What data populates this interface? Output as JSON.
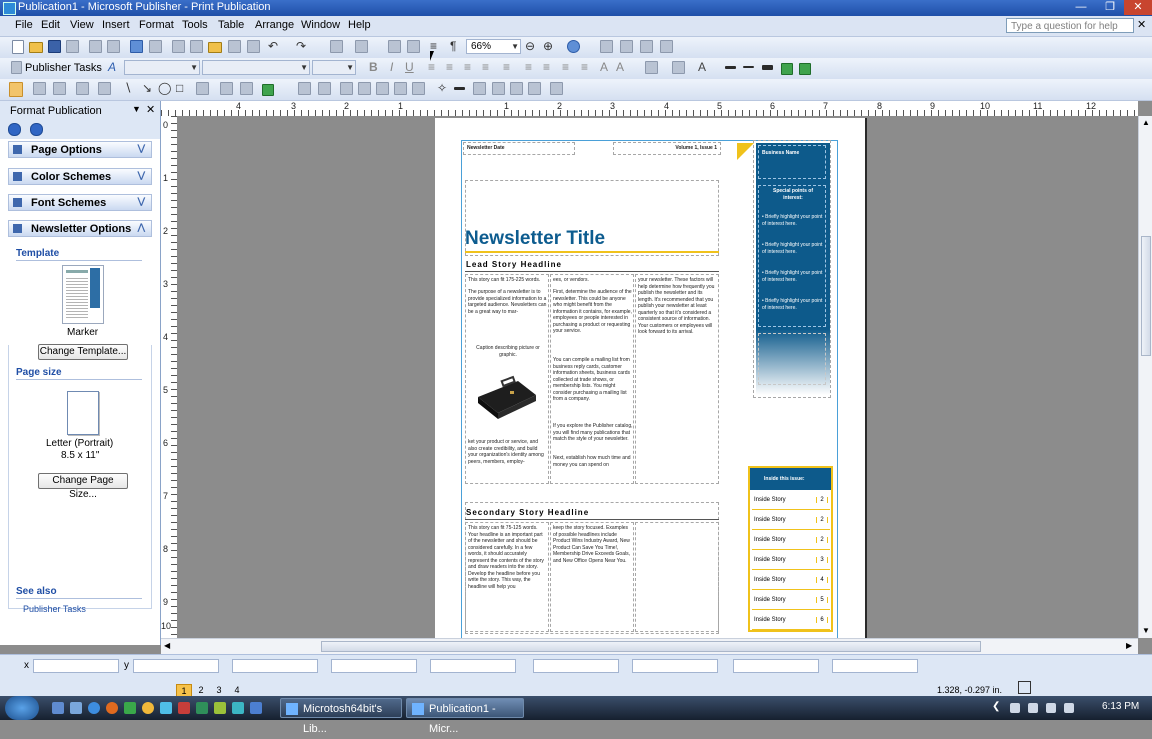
{
  "window": {
    "title": "Publication1 - Microsoft Publisher - Print Publication"
  },
  "menu": [
    "File",
    "Edit",
    "View",
    "Insert",
    "Format",
    "Tools",
    "Table",
    "Arrange",
    "Window",
    "Help"
  ],
  "help_placeholder": "Type a question for help",
  "toolbar": {
    "zoom": "66%",
    "publisher_tasks": "Publisher Tasks"
  },
  "taskpane": {
    "title": "Format Publication",
    "sections": [
      "Page Options",
      "Color Schemes",
      "Font Schemes",
      "Newsletter Options"
    ],
    "template_heading": "Template",
    "template_name": "Marker",
    "change_template": "Change Template...",
    "page_size_heading": "Page size",
    "page_size_name": "Letter (Portrait)",
    "page_size_dims": "8.5 x 11\"",
    "change_page_size": "Change Page Size...",
    "see_also": "See also",
    "see_also_link": "Publisher Tasks"
  },
  "rulers": {
    "h": [
      "4",
      "3",
      "2",
      "1",
      "1",
      "2",
      "3",
      "4",
      "5",
      "6",
      "7",
      "8",
      "9",
      "10",
      "11",
      "12"
    ],
    "v": [
      "0",
      "1",
      "2",
      "3",
      "4",
      "5",
      "6",
      "7",
      "8",
      "9",
      "10"
    ]
  },
  "newsletter": {
    "date": "Newsletter Date",
    "volume": "Volume 1, Issue 1",
    "title": "Newsletter Title",
    "lead_headline": "Lead Story Headline",
    "col1_a": "This story can fit 175-225 words.",
    "col1_b": "The purpose of a newsletter is to provide specialized information to a targeted audience. Newsletters can be a great way to mar-",
    "caption": "Caption describing picture or graphic.",
    "col1_c": "ket your product or service, and also create credibility, and build your organization's identity among peers, members, employ-",
    "col2_a": "ees, or vendors.",
    "col2_b": "First, determine the audience of the newsletter. This could be anyone who might benefit from the information it contains, for example, employees or people interested in purchasing a product or requesting your service.",
    "col2_c": "You can compile a mailing list from business reply cards, customer information sheets, business cards collected at trade shows, or membership lists. You might consider purchasing a mailing list from a company.",
    "col2_d": "If you explore the Publisher catalog, you will find many publications that match the style of your newsletter.",
    "col2_e": "Next, establish how much time and money you can spend on",
    "col3_a": "your newsletter. These factors will help determine how frequently you publish the newsletter and its length. It's recommended that you publish your newsletter at least quarterly so that it's considered a consistent source of information. Your customers or employees will look forward to its arrival.",
    "business_name": "Business Name",
    "special_points": "Special points of interest:",
    "bullets": [
      "Briefly highlight your point of interest here.",
      "Briefly highlight your point of interest here.",
      "Briefly highlight your point of interest here.",
      "Briefly highlight your point of interest here."
    ],
    "secondary_headline": "Secondary Story Headline",
    "sec_col1": "This story can fit 75-125 words. Your headline is an important part of the newsletter and should be considered carefully. In a few words, it should accurately represent the contents of the story and draw readers into the story. Develop the headline before you write the story. This way, the headline will help you",
    "sec_col2": "keep the story focused. Examples of possible headlines include Product Wins Industry Award, New Product Can Save You Time!, Membership Drive Exceeds Goals, and New Office Opens Near You.",
    "inside_title": "Inside this issue:",
    "inside_rows": [
      {
        "label": "Inside Story",
        "page": "2"
      },
      {
        "label": "Inside Story",
        "page": "2"
      },
      {
        "label": "Inside Story",
        "page": "2"
      },
      {
        "label": "Inside Story",
        "page": "3"
      },
      {
        "label": "Inside Story",
        "page": "4"
      },
      {
        "label": "Inside Story",
        "page": "5"
      },
      {
        "label": "Inside Story",
        "page": "6"
      }
    ]
  },
  "status": {
    "x_label": "x",
    "y_label": "y",
    "pages": [
      "1",
      "2",
      "3",
      "4"
    ],
    "coords": "1.328, -0.297 in."
  },
  "taskbar": {
    "tasks": [
      "Microtosh64bit's Lib...",
      "Publication1 - Micr..."
    ],
    "time": "6:13 PM"
  }
}
